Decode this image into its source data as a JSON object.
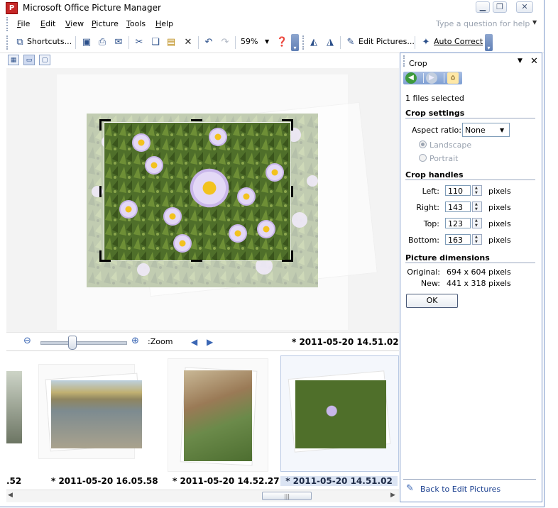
{
  "window": {
    "title": "Microsoft Office Picture Manager",
    "app_icon_letter": "P"
  },
  "menu": {
    "items": [
      {
        "label": "File",
        "accel": "F"
      },
      {
        "label": "Edit",
        "accel": "E"
      },
      {
        "label": "View",
        "accel": "V"
      },
      {
        "label": "Picture",
        "accel": "P"
      },
      {
        "label": "Tools",
        "accel": "T"
      },
      {
        "label": "Help",
        "accel": "H"
      }
    ],
    "help_placeholder": "Type a question for help"
  },
  "toolbar": {
    "shortcuts_label": "Shortcuts...",
    "zoom_value": "59%",
    "edit_pictures_label": "Edit Pictures...",
    "auto_correct_label": "Auto Correct"
  },
  "zoom": {
    "label": ":Zoom",
    "level_fraction": 0.37
  },
  "main": {
    "current_caption": "* 2011-05-20 14.51.02"
  },
  "filmstrip": {
    "items": [
      {
        "caption": ".52"
      },
      {
        "caption": "* 2011-05-20 16.05.58"
      },
      {
        "caption": "* 2011-05-20 14.52.27"
      },
      {
        "caption": "* 2011-05-20 14.51.02",
        "selected": true
      }
    ]
  },
  "pane": {
    "title": "Crop",
    "files_selected": "1 files selected",
    "crop_settings_heading": "Crop settings",
    "aspect_ratio_label": "Aspect ratio:",
    "aspect_ratio_value": "None",
    "orientation_options": [
      "Landscape",
      "Portrait"
    ],
    "crop_handles_heading": "Crop handles",
    "handles": [
      {
        "label": "Left:",
        "value": "110",
        "units": "pixels"
      },
      {
        "label": "Right:",
        "value": "143",
        "units": "pixels"
      },
      {
        "label": "Top:",
        "value": "123",
        "units": "pixels"
      },
      {
        "label": "Bottom:",
        "value": "163",
        "units": "pixels"
      }
    ],
    "dimensions_heading": "Picture dimensions",
    "original_label": "Original:",
    "original_value": "694 x 604 pixels",
    "new_label": "New:",
    "new_value": "441 x 318 pixels",
    "ok_label": "OK",
    "back_link": "Back to Edit Pictures"
  },
  "colors": {
    "accent": "#3a66b4",
    "pane_border": "#7a96c8"
  }
}
